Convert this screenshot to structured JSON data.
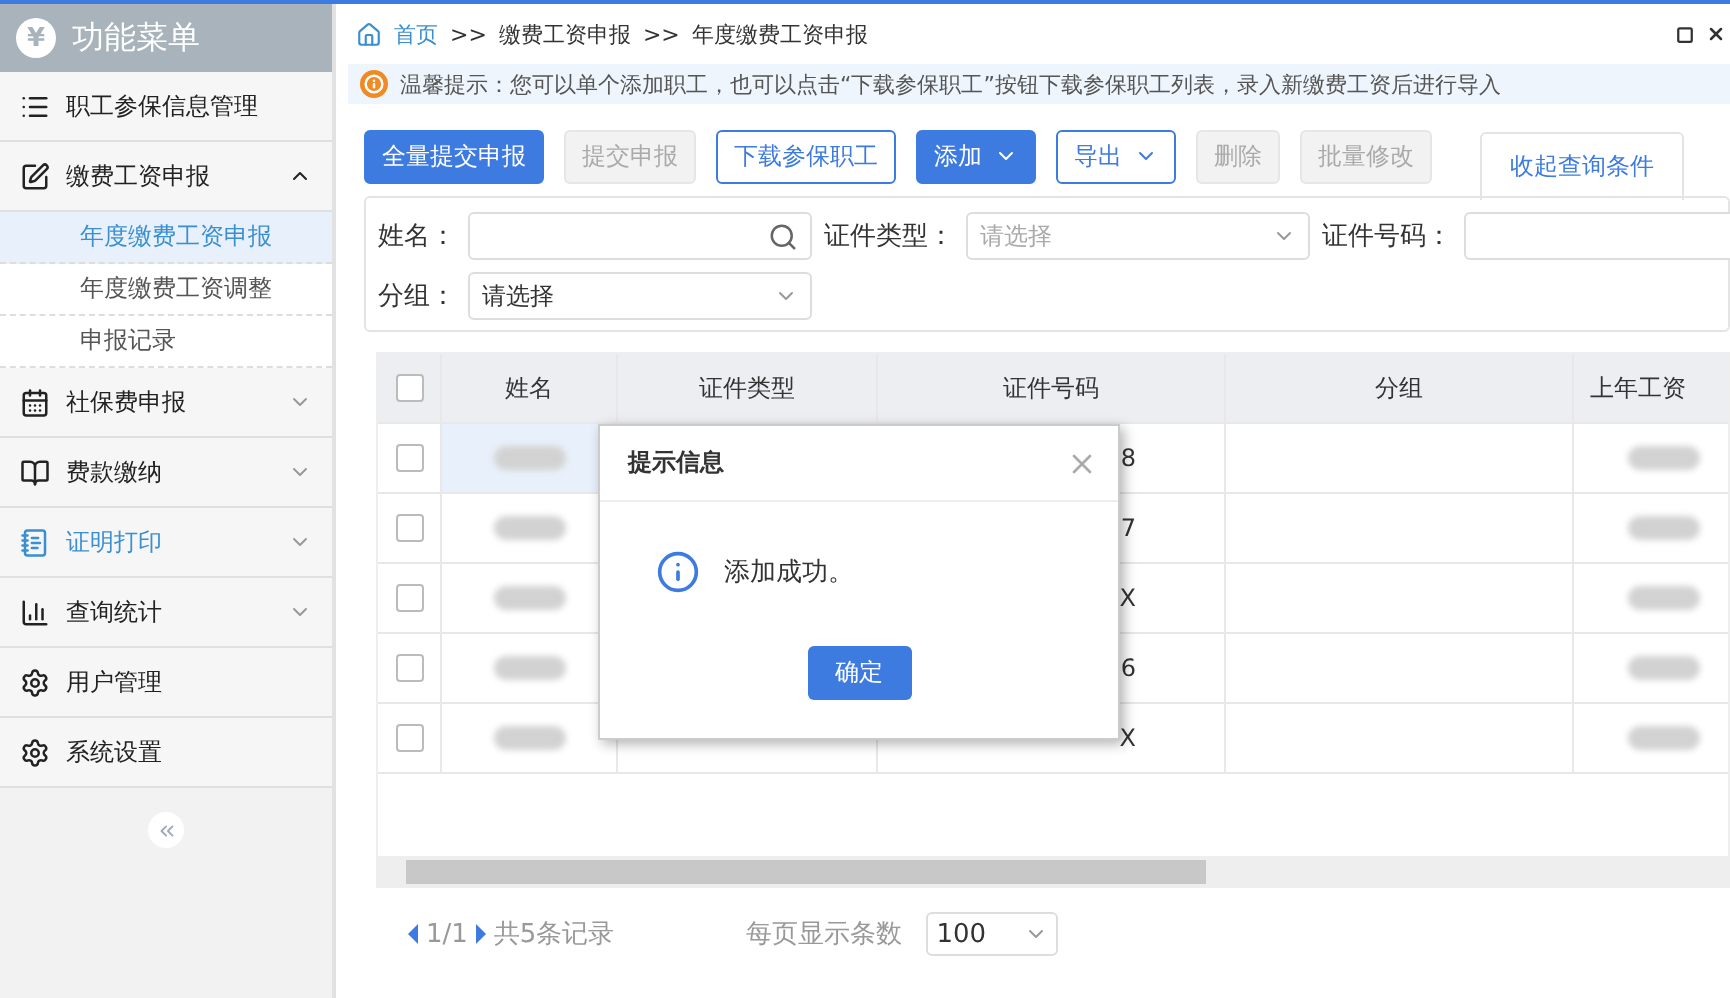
{
  "sidebar": {
    "logo": "¥",
    "title": "功能菜单",
    "items": [
      {
        "kind": "link",
        "label": "职工参保信息管理",
        "highlighted": false
      },
      {
        "kind": "group",
        "label": "缴费工资申报",
        "expanded": true,
        "highlighted": false,
        "children": [
          {
            "label": "年度缴费工资申报",
            "selected": true
          },
          {
            "label": "年度缴费工资调整",
            "selected": false
          },
          {
            "label": "申报记录",
            "selected": false
          }
        ]
      },
      {
        "kind": "group",
        "label": "社保费申报",
        "expanded": false,
        "highlighted": false
      },
      {
        "kind": "group",
        "label": "费款缴纳",
        "expanded": false,
        "highlighted": false
      },
      {
        "kind": "group",
        "label": "证明打印",
        "expanded": false,
        "highlighted": true
      },
      {
        "kind": "group",
        "label": "查询统计",
        "expanded": false,
        "highlighted": false
      },
      {
        "kind": "link",
        "label": "用户管理",
        "highlighted": false
      },
      {
        "kind": "link",
        "label": "系统设置",
        "highlighted": false
      }
    ]
  },
  "breadcrumb": {
    "separator": ">>",
    "items": [
      "首页",
      "缴费工资申报",
      "年度缴费工资申报"
    ]
  },
  "tip": "温馨提示：您可以单个添加职工，也可以点击“下载参保职工”按钮下载参保职工列表，录入新缴费工资后进行导入",
  "toolbar": [
    {
      "label": "全量提交申报",
      "kind": "primary",
      "dropdown": false
    },
    {
      "label": "提交申报",
      "kind": "disabled",
      "dropdown": false
    },
    {
      "label": "下载参保职工",
      "kind": "outline",
      "dropdown": false
    },
    {
      "label": "添加",
      "kind": "primary",
      "dropdown": true
    },
    {
      "label": "导出",
      "kind": "outline",
      "dropdown": true
    },
    {
      "label": "删除",
      "kind": "disabled",
      "dropdown": false
    },
    {
      "label": "批量修改",
      "kind": "disabled",
      "dropdown": false
    }
  ],
  "collapse_filters": "收起查询条件",
  "filters": [
    {
      "label": "姓名：",
      "kind": "search"
    },
    {
      "label": "证件类型：",
      "kind": "select",
      "placeholder": "请选择"
    },
    {
      "label": "证件号码：",
      "kind": "text"
    },
    {
      "label": "分组：",
      "kind": "select",
      "value": "请选择"
    }
  ],
  "table": {
    "all_checked": false,
    "columns": [
      "姓名",
      "证件类型",
      "证件号码",
      "分组",
      "上年工资"
    ],
    "rows": [
      {
        "checked": false,
        "id_number": "8"
      },
      {
        "checked": false,
        "id_number": "7"
      },
      {
        "checked": false,
        "id_number": "X"
      },
      {
        "checked": false,
        "id_number": "6"
      },
      {
        "checked": false,
        "id_number": "X"
      }
    ]
  },
  "pagination": {
    "page": "1/1",
    "total": "共5条记录",
    "page_size_label": "每页显示条数",
    "page_size": "100"
  },
  "dialog": {
    "title": "提示信息",
    "message": "添加成功。",
    "button": "确定"
  }
}
